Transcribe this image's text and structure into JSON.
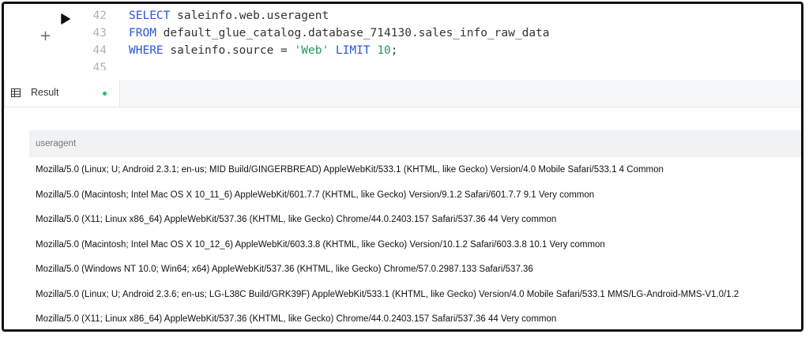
{
  "editor": {
    "lines": [
      {
        "number": "42",
        "parts": [
          {
            "t": "SELECT",
            "c": "kw"
          },
          {
            "t": " saleinfo.web.useragent",
            "c": ""
          }
        ]
      },
      {
        "number": "43",
        "parts": [
          {
            "t": "FROM",
            "c": "kw"
          },
          {
            "t": " default_glue_catalog.database_714130.sales_info_raw_data",
            "c": ""
          }
        ]
      },
      {
        "number": "44",
        "parts": [
          {
            "t": "WHERE",
            "c": "kw"
          },
          {
            "t": " saleinfo.source = ",
            "c": ""
          },
          {
            "t": "'Web'",
            "c": "str"
          },
          {
            "t": " ",
            "c": ""
          },
          {
            "t": "LIMIT",
            "c": "kw"
          },
          {
            "t": " ",
            "c": ""
          },
          {
            "t": "10",
            "c": "num"
          },
          {
            "t": ";",
            "c": ""
          }
        ]
      },
      {
        "number": "45",
        "parts": []
      }
    ],
    "run_icon": "play-icon",
    "add_icon": "plus-icon",
    "add_label": "+"
  },
  "result_tab": {
    "icon": "table-grid-icon",
    "label": "Result",
    "status_color": "#22c55e"
  },
  "table": {
    "column": "useragent",
    "rows": [
      "Mozilla/5.0 (Linux; U; Android 2.3.1; en-us; MID Build/GINGERBREAD) AppleWebKit/533.1 (KHTML, like Gecko) Version/4.0 Mobile Safari/533.1 4 Common",
      "Mozilla/5.0 (Macintosh; Intel Mac OS X 10_11_6) AppleWebKit/601.7.7 (KHTML, like Gecko) Version/9.1.2 Safari/601.7.7 9.1 Very common",
      "Mozilla/5.0 (X11; Linux x86_64) AppleWebKit/537.36 (KHTML, like Gecko) Chrome/44.0.2403.157 Safari/537.36 44 Very common",
      "Mozilla/5.0 (Macintosh; Intel Mac OS X 10_12_6) AppleWebKit/603.3.8 (KHTML, like Gecko) Version/10.1.2 Safari/603.3.8 10.1 Very common",
      "Mozilla/5.0 (Windows NT 10.0; Win64; x64) AppleWebKit/537.36 (KHTML, like Gecko) Chrome/57.0.2987.133 Safari/537.36",
      "Mozilla/5.0 (Linux; U; Android 2.3.6; en-us; LG-L38C Build/GRK39F) AppleWebKit/533.1 (KHTML, like Gecko) Version/4.0 Mobile Safari/533.1 MMS/LG-Android-MMS-V1.0/1.2",
      "Mozilla/5.0 (X11; Linux x86_64) AppleWebKit/537.36 (KHTML, like Gecko) Chrome/44.0.2403.157 Safari/537.36 44 Very common"
    ]
  }
}
